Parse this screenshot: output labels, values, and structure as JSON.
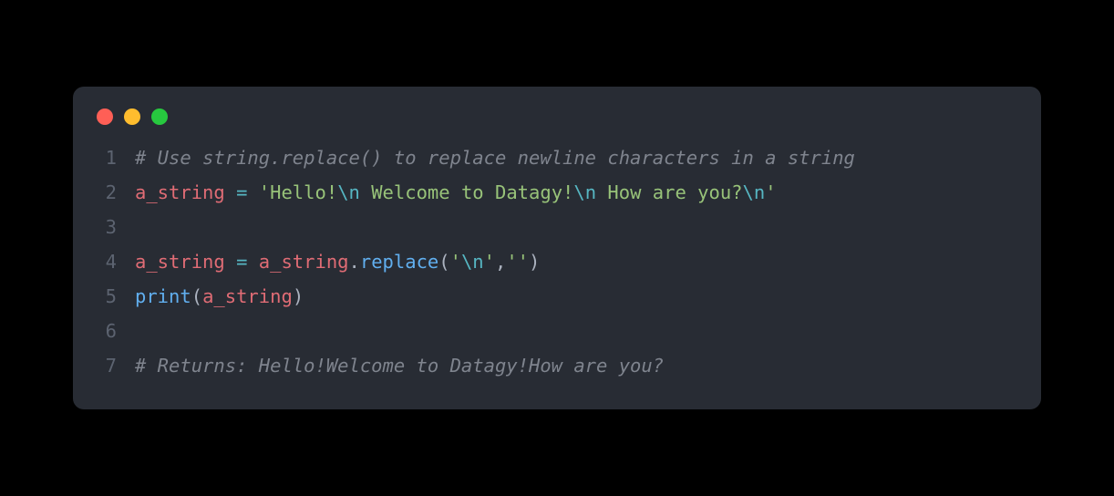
{
  "window": {
    "controls": [
      "close",
      "minimize",
      "maximize"
    ]
  },
  "code": {
    "lines": [
      {
        "num": "1",
        "tokens": [
          {
            "cls": "tok-comment",
            "text": "# Use string.replace() to replace newline characters in a string"
          }
        ]
      },
      {
        "num": "2",
        "tokens": [
          {
            "cls": "tok-var",
            "text": "a_string"
          },
          {
            "cls": "tok-default",
            "text": " "
          },
          {
            "cls": "tok-operator",
            "text": "="
          },
          {
            "cls": "tok-default",
            "text": " "
          },
          {
            "cls": "tok-string",
            "text": "'Hello!"
          },
          {
            "cls": "tok-escape",
            "text": "\\n"
          },
          {
            "cls": "tok-string",
            "text": " Welcome to Datagy!"
          },
          {
            "cls": "tok-escape",
            "text": "\\n"
          },
          {
            "cls": "tok-string",
            "text": " How are you?"
          },
          {
            "cls": "tok-escape",
            "text": "\\n"
          },
          {
            "cls": "tok-string",
            "text": "'"
          }
        ]
      },
      {
        "num": "3",
        "tokens": []
      },
      {
        "num": "4",
        "tokens": [
          {
            "cls": "tok-var",
            "text": "a_string"
          },
          {
            "cls": "tok-default",
            "text": " "
          },
          {
            "cls": "tok-operator",
            "text": "="
          },
          {
            "cls": "tok-default",
            "text": " "
          },
          {
            "cls": "tok-var",
            "text": "a_string"
          },
          {
            "cls": "tok-punct",
            "text": "."
          },
          {
            "cls": "tok-method",
            "text": "replace"
          },
          {
            "cls": "tok-punct",
            "text": "("
          },
          {
            "cls": "tok-string",
            "text": "'"
          },
          {
            "cls": "tok-escape",
            "text": "\\n"
          },
          {
            "cls": "tok-string",
            "text": "'"
          },
          {
            "cls": "tok-punct",
            "text": ","
          },
          {
            "cls": "tok-string",
            "text": "''"
          },
          {
            "cls": "tok-punct",
            "text": ")"
          }
        ]
      },
      {
        "num": "5",
        "tokens": [
          {
            "cls": "tok-builtin",
            "text": "print"
          },
          {
            "cls": "tok-punct",
            "text": "("
          },
          {
            "cls": "tok-var",
            "text": "a_string"
          },
          {
            "cls": "tok-punct",
            "text": ")"
          }
        ]
      },
      {
        "num": "6",
        "tokens": []
      },
      {
        "num": "7",
        "tokens": [
          {
            "cls": "tok-comment",
            "text": "# Returns: Hello!Welcome to Datagy!How are you?"
          }
        ]
      }
    ]
  }
}
